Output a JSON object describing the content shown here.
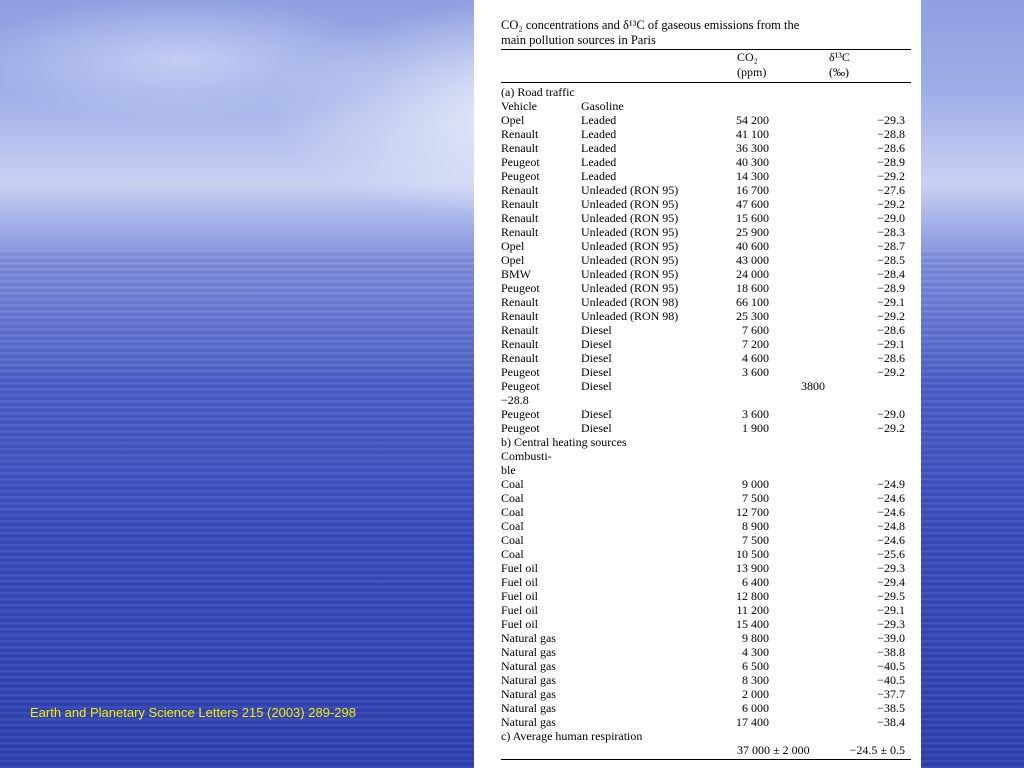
{
  "citation": "Earth and Planetary Science Letters 215 (2003) 289-298",
  "table": {
    "title_line1": "CO₂ concentrations and δ¹³C of gaseous emissions from the",
    "title_line2": "main pollution sources in Paris",
    "col_co2": "CO₂",
    "col_co2_unit": "(ppm)",
    "col_d13c": "δ¹³C",
    "col_d13c_unit": "(‰)",
    "section_a": "(a) Road traffic",
    "section_a_head1": "Vehicle",
    "section_a_head2": "Gasoline",
    "road_rows": [
      [
        "Opel",
        "Leaded",
        "54 200",
        "−29.3"
      ],
      [
        "Renault",
        "Leaded",
        "41 100",
        "−28.8"
      ],
      [
        "Renault",
        "Leaded",
        "36 300",
        "−28.6"
      ],
      [
        "Peugeot",
        "Leaded",
        "40 300",
        "−28.9"
      ],
      [
        "Peugeot",
        "Leaded",
        "14 300",
        "−29.2"
      ],
      [
        "Renault",
        "Unleaded (RON 95)",
        "16 700",
        "−27.6"
      ],
      [
        "Renault",
        "Unleaded (RON 95)",
        "47 600",
        "−29.2"
      ],
      [
        "Renault",
        "Unleaded (RON 95)",
        "15 600",
        "−29.0"
      ],
      [
        "Renault",
        "Unleaded (RON 95)",
        "25 900",
        "−28.3"
      ],
      [
        "Opel",
        "Unleaded (RON 95)",
        "40 600",
        "−28.7"
      ],
      [
        "Opel",
        "Unleaded (RON 95)",
        "43 000",
        "−28.5"
      ],
      [
        "BMW",
        "Unleaded (RON 95)",
        "24 000",
        "−28.4"
      ],
      [
        "Peugeot",
        "Unleaded (RON 95)",
        "18 600",
        "−28.9"
      ],
      [
        "Renault",
        "Unleaded (RON 98)",
        "66 100",
        "−29.1"
      ],
      [
        "Renault",
        "Unleaded (RON 98)",
        "25 300",
        "−29.2"
      ],
      [
        "Renault",
        "Diesel",
        "7 600",
        "−28.6"
      ],
      [
        "Renault",
        "Diesel",
        "7 200",
        "−29.1"
      ],
      [
        "Renault",
        "Diesel",
        "4 600",
        "−28.6"
      ],
      [
        "Peugeot",
        "Diesel",
        "3 600",
        "−29.2"
      ]
    ],
    "odd_row": {
      "c1": "Peugeot",
      "c2": "Diesel",
      "value": "3800",
      "wrap": "−28.8"
    },
    "road_rows_tail": [
      [
        "Peugeot",
        "Diesel",
        "3 600",
        "−29.0"
      ],
      [
        "Peugeot",
        "Diesel",
        "1 900",
        "−29.2"
      ]
    ],
    "section_b": "b) Central heating sources",
    "section_b_head_l1": "Combusti-",
    "section_b_head_l2": "ble",
    "heat_rows": [
      [
        "Coal",
        "9 000",
        "−24.9"
      ],
      [
        "Coal",
        "7 500",
        "−24.6"
      ],
      [
        "Coal",
        "12 700",
        "−24.6"
      ],
      [
        "Coal",
        "8 900",
        "−24.8"
      ],
      [
        "Coal",
        "7 500",
        "−24.6"
      ],
      [
        "Coal",
        "10 500",
        "−25.6"
      ],
      [
        "Fuel oil",
        "13 900",
        "−29.3"
      ],
      [
        "Fuel oil",
        "6 400",
        "−29.4"
      ],
      [
        "Fuel oil",
        "12 800",
        "−29.5"
      ],
      [
        "Fuel oil",
        "11 200",
        "−29.1"
      ],
      [
        "Fuel oil",
        "15 400",
        "−29.3"
      ],
      [
        "Natural gas",
        "9 800",
        "−39.0"
      ],
      [
        "Natural gas",
        "4 300",
        "−38.8"
      ],
      [
        "Natural gas",
        "6 500",
        "−40.5"
      ],
      [
        "Natural gas",
        "8 300",
        "−40.5"
      ],
      [
        "Natural gas",
        "2 000",
        "−37.7"
      ],
      [
        "Natural gas",
        "6 000",
        "−38.5"
      ],
      [
        "Natural gas",
        "17 400",
        "−38.4"
      ]
    ],
    "section_c": "c) Average human respiration",
    "resp_co2": "37 000 ± 2 000",
    "resp_d13c": "−24.5 ± 0.5"
  }
}
